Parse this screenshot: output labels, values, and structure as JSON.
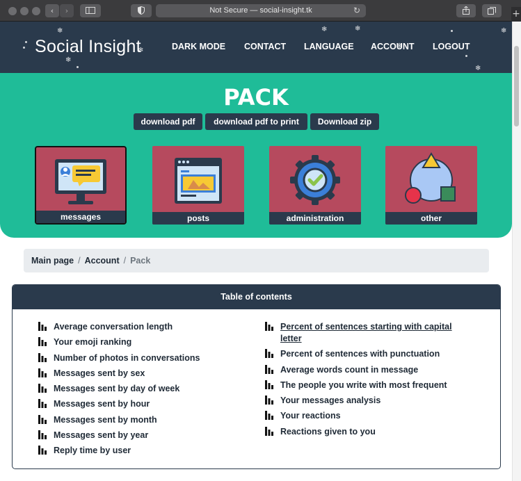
{
  "browser": {
    "url_text": "Not Secure — social-insight.tk",
    "plus_label": "+"
  },
  "header": {
    "logo": "Social Insight",
    "nav": [
      "DARK MODE",
      "CONTACT",
      "LANGUAGE",
      "ACCOUNT",
      "LOGOUT"
    ]
  },
  "hero": {
    "title": "PACK",
    "downloads": [
      "download pdf",
      "download pdf to print",
      "Download zip"
    ],
    "cards": [
      {
        "label": "messages",
        "icon": "monitor-chat-icon",
        "active": true
      },
      {
        "label": "posts",
        "icon": "browser-window-icon",
        "active": false
      },
      {
        "label": "administration",
        "icon": "gear-check-icon",
        "active": false
      },
      {
        "label": "other",
        "icon": "shapes-icon",
        "active": false
      }
    ]
  },
  "breadcrumb": {
    "items": [
      "Main page",
      "Account"
    ],
    "current": "Pack",
    "separator": "/"
  },
  "toc": {
    "title": "Table of contents",
    "left": [
      "Average conversation length",
      "Your emoji ranking",
      "Number of photos in conversations",
      "Messages sent by sex",
      "Messages sent by day of week",
      "Messages sent by hour",
      "Messages sent by month",
      "Messages sent by year",
      "Reply time by user"
    ],
    "right": [
      "Percent of sentences starting with capital letter",
      "Percent of sentences with punctuation",
      "Average words count in message",
      "The people you write with most frequent",
      "Your messages analysis",
      "Your reactions",
      "Reactions given to you"
    ]
  },
  "colors": {
    "navy": "#2a3a4c",
    "green": "#1fbc98",
    "card": "#b64a5e"
  }
}
